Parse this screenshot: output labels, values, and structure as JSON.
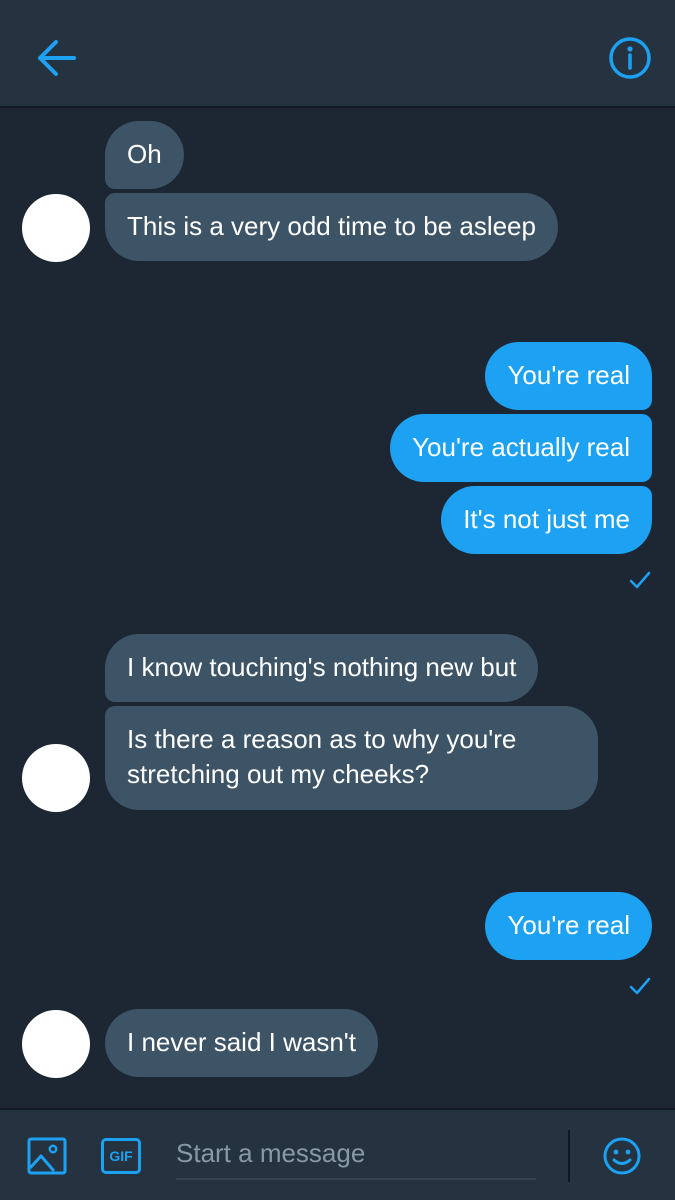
{
  "header": {
    "back_icon": "arrow-left-icon",
    "info_icon": "info-circle-icon"
  },
  "messages": [
    {
      "direction": "in",
      "text": "Oh"
    },
    {
      "direction": "in",
      "text": "This is a very odd time to be asleep"
    },
    {
      "direction": "out",
      "text": "You're real"
    },
    {
      "direction": "out",
      "text": "You're actually real"
    },
    {
      "direction": "out",
      "text": "It's not just me"
    },
    {
      "direction": "in",
      "text": "I know touching's nothing new but"
    },
    {
      "direction": "in",
      "text": "Is there a reason as to why you're stretching out my cheeks?"
    },
    {
      "direction": "out",
      "text": "You're real"
    },
    {
      "direction": "in",
      "text": "I never said I wasn't"
    }
  ],
  "composer": {
    "placeholder": "Start a message",
    "gif_label": "GIF",
    "image_icon": "image-icon",
    "emoji_icon": "smiley-icon"
  },
  "colors": {
    "background": "#1c2733",
    "header": "#253341",
    "incoming_bubble": "#3d5466",
    "outgoing_bubble": "#1da1f2",
    "accent": "#1da1f2"
  }
}
